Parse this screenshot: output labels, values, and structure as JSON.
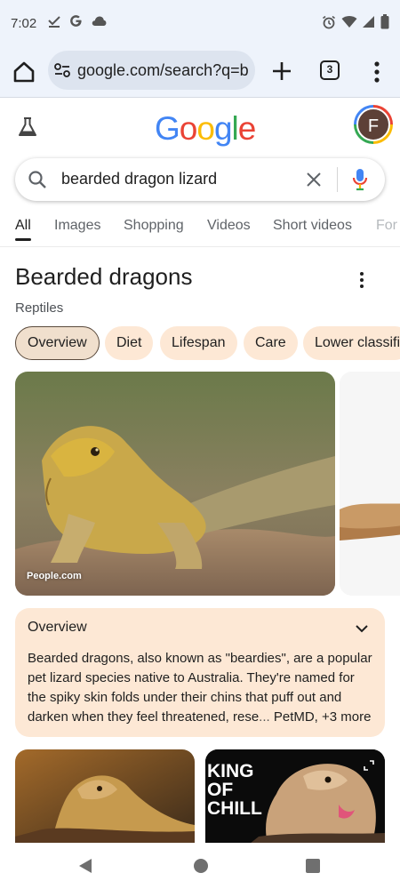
{
  "status_bar": {
    "time": "7:02",
    "left_icons": [
      "checkmark-download-icon",
      "google-g-icon",
      "cloud-icon"
    ],
    "right_icons": [
      "alarm-icon",
      "wifi-icon",
      "signal-icon",
      "battery-icon"
    ]
  },
  "browser": {
    "url": "google.com/search?q=b",
    "tab_count": "3"
  },
  "google": {
    "logo_letters": [
      {
        "char": "G",
        "color": "#4285f4"
      },
      {
        "char": "o",
        "color": "#ea4335"
      },
      {
        "char": "o",
        "color": "#fbbc05"
      },
      {
        "char": "g",
        "color": "#4285f4"
      },
      {
        "char": "l",
        "color": "#34a853"
      },
      {
        "char": "e",
        "color": "#ea4335"
      }
    ],
    "avatar_initial": "F"
  },
  "search": {
    "query": "bearded dragon lizard"
  },
  "tabs": [
    {
      "label": "All",
      "active": true
    },
    {
      "label": "Images"
    },
    {
      "label": "Shopping"
    },
    {
      "label": "Videos"
    },
    {
      "label": "Short videos"
    },
    {
      "label": "For"
    }
  ],
  "knowledge_panel": {
    "title": "Bearded dragons",
    "subtitle": "Reptiles",
    "chips": [
      {
        "label": "Overview",
        "selected": true
      },
      {
        "label": "Diet"
      },
      {
        "label": "Lifespan"
      },
      {
        "label": "Care"
      },
      {
        "label": "Lower classifi"
      }
    ],
    "hero_image_source": "People.com",
    "overview": {
      "title": "Overview",
      "text": "Bearded dragons, also known as \"beardies\", are a popular pet lizard species native to Australia. They're named for the spiky skin folds under their chins that puff out and darken when they feel threatened, rese",
      "ellipsis": "... ",
      "source": "PetMD, +3 more"
    }
  },
  "video_thumbnails": [
    {
      "overlay_text": ""
    },
    {
      "overlay_text": "KING\nOF\nCHILL"
    }
  ],
  "colors": {
    "chip_bg": "#fde8d5",
    "chrome_bg": "#eef3fb",
    "mic_blue": "#4285f4"
  }
}
